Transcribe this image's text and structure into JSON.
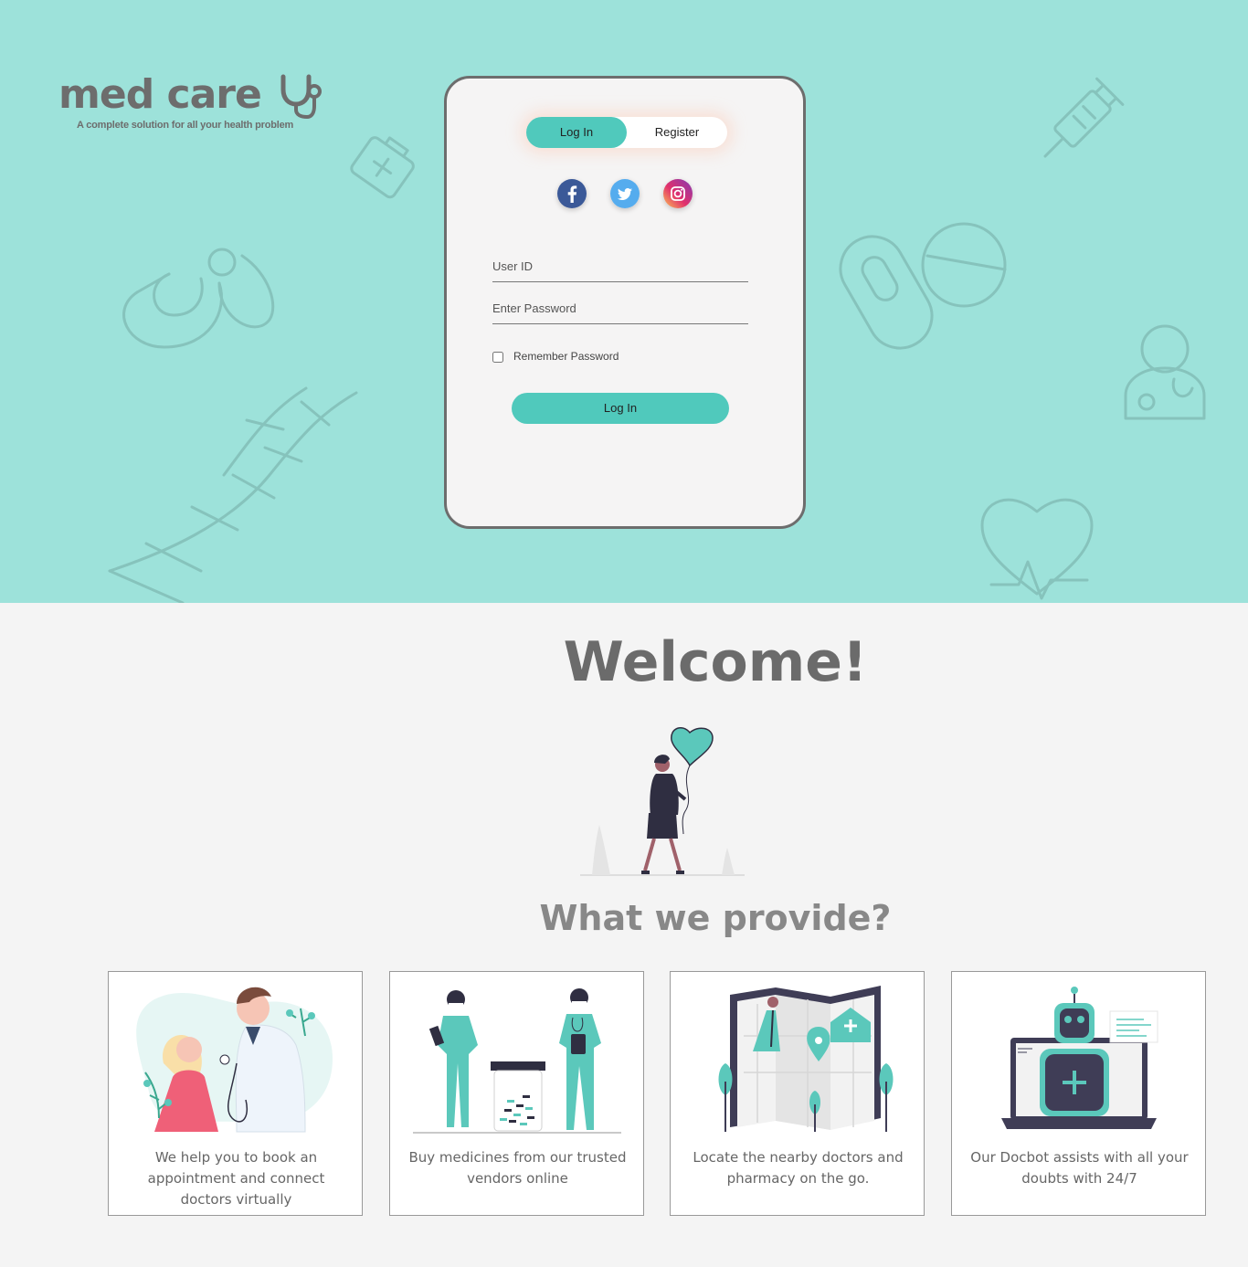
{
  "brand": {
    "name": "med care",
    "tagline": "A complete solution for all your health problem"
  },
  "auth": {
    "tabs": {
      "login": "Log In",
      "register": "Register"
    },
    "active_tab": "login",
    "social_icons": [
      "facebook-icon",
      "twitter-icon",
      "instagram-icon"
    ],
    "user_id_placeholder": "User ID",
    "password_placeholder": "Enter Password",
    "remember_label": "Remember Password",
    "remember_checked": false,
    "submit_label": "Log In"
  },
  "welcome": {
    "heading": "Welcome!",
    "subheading": "What we provide?"
  },
  "features": [
    {
      "illustration": "doctor-consultation",
      "text": "We help you to book an appointment and connect doctors virtually"
    },
    {
      "illustration": "pharmacy-medicines",
      "text": "Buy medicines from our trusted vendors online"
    },
    {
      "illustration": "map-location",
      "text": "Locate the nearby doctors and pharmacy on the go."
    },
    {
      "illustration": "docbot-robot",
      "text": "Our Docbot assists with all your doubts with 24/7"
    }
  ],
  "colors": {
    "hero_bg": "#9de2da",
    "accent": "#50c9bc",
    "text_gray": "#6d6d6d",
    "page_bg": "#f4f4f4"
  }
}
